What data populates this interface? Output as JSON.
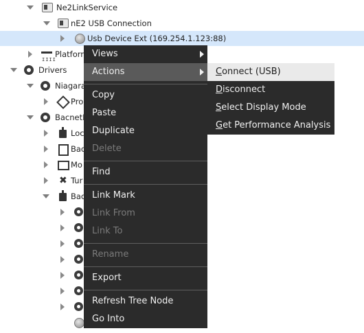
{
  "tree": {
    "rows": [
      {
        "label": "Ne2LinkService"
      },
      {
        "label": "nE2 USB Connection"
      },
      {
        "label": "Usb Device Ext (169.254.1.123:88)"
      },
      {
        "label": "Platform"
      },
      {
        "label": "Drivers"
      },
      {
        "label": "Niagara"
      },
      {
        "label": "Pro"
      },
      {
        "label": "BacnetN"
      },
      {
        "label": "Loc"
      },
      {
        "label": "Bac"
      },
      {
        "label": "Mo"
      },
      {
        "label": "Tur"
      },
      {
        "label": "Bac"
      }
    ]
  },
  "context_menu": {
    "items": [
      {
        "label": "Views",
        "enabled": true,
        "submenu": true
      },
      {
        "label": "Actions",
        "enabled": true,
        "submenu": true,
        "highlighted": true
      },
      {
        "label": "Copy",
        "enabled": true
      },
      {
        "label": "Paste",
        "enabled": true
      },
      {
        "label": "Duplicate",
        "enabled": true
      },
      {
        "label": "Delete",
        "enabled": false
      },
      {
        "label": "Find",
        "enabled": true
      },
      {
        "label": "Link Mark",
        "enabled": true
      },
      {
        "label": "Link From",
        "enabled": false
      },
      {
        "label": "Link To",
        "enabled": false
      },
      {
        "label": "Rename",
        "enabled": false
      },
      {
        "label": "Export",
        "enabled": true
      },
      {
        "label": "Refresh Tree Node",
        "enabled": true
      },
      {
        "label": "Go Into",
        "enabled": true
      }
    ]
  },
  "actions_submenu": {
    "items": [
      {
        "first": "C",
        "rest": "onnect (USB)",
        "highlighted": true
      },
      {
        "first": "D",
        "rest": "isconnect"
      },
      {
        "first": "S",
        "rest": "elect Display Mode"
      },
      {
        "first": "G",
        "rest": "et Performance Analysis"
      }
    ]
  },
  "colors": {
    "menu_bg": "#2b2b2b",
    "menu_text": "#f0f0f0",
    "menu_disabled": "#7b7b7b",
    "selection": "#d5e7fb"
  }
}
